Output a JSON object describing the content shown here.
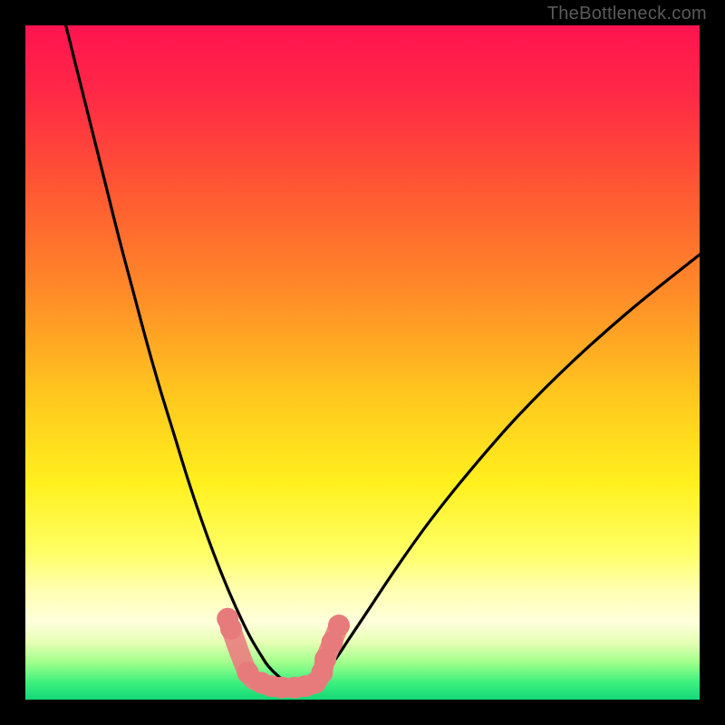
{
  "watermark": "TheBottleneck.com",
  "chart_data": {
    "type": "line",
    "title": "",
    "xlabel": "",
    "ylabel": "",
    "xlim": [
      0,
      100
    ],
    "ylim": [
      0,
      100
    ],
    "description": "Bottleneck curve with V-shaped minimum over vertical rainbow gradient (red at top = high bottleneck, green at bottom = balanced). Minimum occurs near x≈38.",
    "gradient_stops": [
      {
        "pos": 0.0,
        "color": "#ff1450"
      },
      {
        "pos": 0.1,
        "color": "#ff2846"
      },
      {
        "pos": 0.25,
        "color": "#ff5a32"
      },
      {
        "pos": 0.4,
        "color": "#ff8c28"
      },
      {
        "pos": 0.55,
        "color": "#ffc81e"
      },
      {
        "pos": 0.68,
        "color": "#fff01e"
      },
      {
        "pos": 0.78,
        "color": "#ffff64"
      },
      {
        "pos": 0.84,
        "color": "#ffffb4"
      },
      {
        "pos": 0.885,
        "color": "#ffffdc"
      },
      {
        "pos": 0.915,
        "color": "#e6ffb4"
      },
      {
        "pos": 0.945,
        "color": "#a0ff8c"
      },
      {
        "pos": 0.975,
        "color": "#3cf07e"
      },
      {
        "pos": 1.0,
        "color": "#14d878"
      }
    ],
    "series": [
      {
        "name": "left-branch",
        "x": [
          6,
          8,
          10,
          12,
          14,
          16,
          18,
          20,
          22,
          24,
          26,
          28,
          30,
          32,
          33.5,
          35,
          36,
          37.5,
          39,
          41,
          42.5
        ],
        "y": [
          100,
          92,
          84,
          76,
          68,
          60.5,
          53,
          46,
          39.5,
          33,
          27,
          21.5,
          16.5,
          12,
          9,
          6.5,
          5,
          3.5,
          2.5,
          2.2,
          2.2
        ]
      },
      {
        "name": "right-branch",
        "x": [
          42.5,
          44,
          46,
          48,
          51,
          55,
          60,
          66,
          73,
          81,
          90,
          100
        ],
        "y": [
          2.2,
          3.5,
          6,
          9,
          13.5,
          19.5,
          26.5,
          34,
          42,
          50,
          58,
          66
        ]
      },
      {
        "name": "data-band",
        "type": "scatter",
        "x": [
          30,
          30.5,
          33,
          35,
          36.5,
          38,
          40,
          41.5,
          43,
          44,
          44.5,
          45.5,
          46.5
        ],
        "y": [
          12,
          10.5,
          4,
          2.5,
          2,
          1.8,
          1.8,
          2,
          2.5,
          4,
          6,
          8.5,
          11
        ]
      }
    ]
  }
}
